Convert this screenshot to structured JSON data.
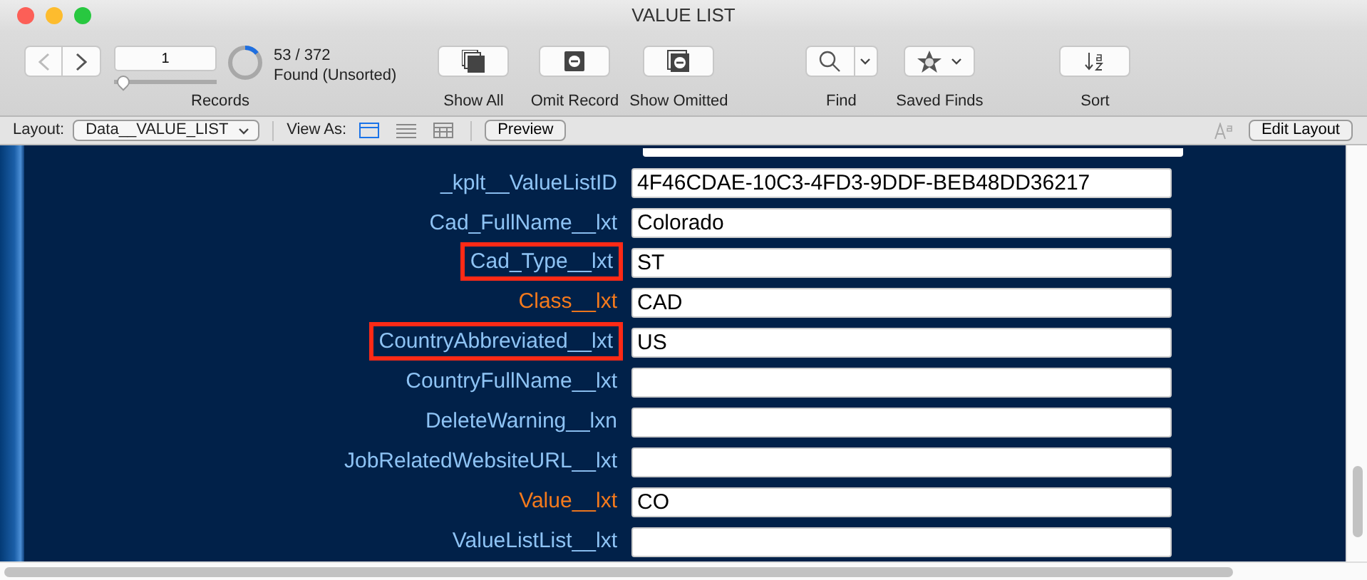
{
  "window": {
    "title": "VALUE LIST"
  },
  "toolbar": {
    "record_number": "1",
    "record_slider": {
      "level": 0
    },
    "found_ring": {
      "level": 0.142
    },
    "found_count": "53 / 372",
    "found_status": "Found (Unsorted)",
    "records_label": "Records",
    "buttons": [
      {
        "kind": "show-all",
        "label": "Show All"
      },
      {
        "kind": "omit",
        "label": "Omit Record"
      },
      {
        "kind": "show-omitted",
        "label": "Show Omitted"
      },
      {
        "kind": "find",
        "label": "Find"
      },
      {
        "kind": "saved-finds",
        "label": "Saved Finds"
      },
      {
        "kind": "sort",
        "label": "Sort"
      }
    ]
  },
  "layout_bar": {
    "layout_label": "Layout:",
    "layout_value": "Data__VALUE_LIST",
    "view_as_label": "View As:",
    "views": [
      {
        "kind": "form",
        "selected": true
      },
      {
        "kind": "list",
        "selected": false
      },
      {
        "kind": "table",
        "selected": false
      }
    ],
    "preview_button": "Preview",
    "edit_layout_button": "Edit Layout"
  },
  "fields": [
    {
      "label": "_kplt__ValueListID",
      "value": "4F46CDAE-10C3-4FD3-9DDF-BEB48DD36217",
      "color": "#8ec3f4",
      "highlighted": false
    },
    {
      "label": "Cad_FullName__lxt",
      "value": "Colorado",
      "color": "#8ec3f4",
      "highlighted": false
    },
    {
      "label": "Cad_Type__lxt",
      "value": "ST",
      "color": "#8ec3f4",
      "highlighted": true
    },
    {
      "label": "Class__lxt",
      "value": "CAD",
      "color": "#f57a1c",
      "highlighted": false
    },
    {
      "label": "CountryAbbreviated__lxt",
      "value": "US",
      "color": "#8ec3f4",
      "highlighted": true
    },
    {
      "label": "CountryFullName__lxt",
      "color": "#8ec3f4",
      "highlighted": false
    },
    {
      "label": "DeleteWarning__lxn",
      "color": "#8ec3f4",
      "highlighted": false
    },
    {
      "label": "JobRelatedWebsiteURL__lxt",
      "color": "#8ec3f4",
      "highlighted": false
    },
    {
      "label": "Value__lxt",
      "value": "CO",
      "color": "#f57a1c",
      "highlighted": false
    },
    {
      "label": "ValueListList__lxt",
      "color": "#8ec3f4",
      "highlighted": false
    }
  ]
}
